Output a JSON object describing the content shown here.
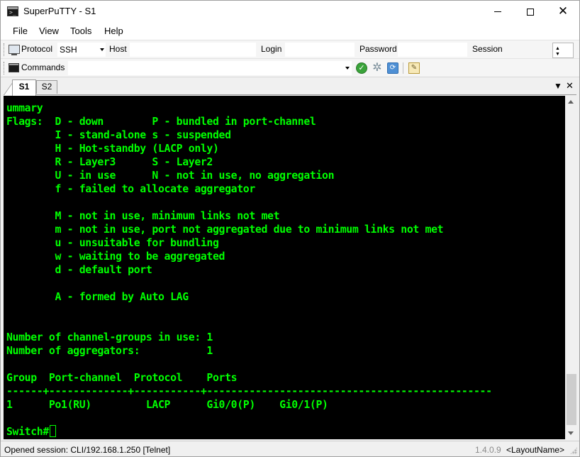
{
  "window": {
    "title": "SuperPuTTY - S1"
  },
  "menu": {
    "items": [
      "File",
      "View",
      "Tools",
      "Help"
    ]
  },
  "toolbar": {
    "protocol_label": "Protocol",
    "protocol_value": "SSH",
    "host_label": "Host",
    "host_value": "",
    "login_label": "Login",
    "login_value": "",
    "password_label": "Password",
    "password_value": "",
    "session_label": "Session",
    "commands_label": "Commands",
    "commands_value": ""
  },
  "tabs": [
    {
      "label": "S1",
      "active": true
    },
    {
      "label": "S2",
      "active": false
    }
  ],
  "terminal": {
    "color": "#00ff00",
    "background": "#000000",
    "lines": [
      "ummary",
      "Flags:  D - down        P - bundled in port-channel",
      "        I - stand-alone s - suspended",
      "        H - Hot-standby (LACP only)",
      "        R - Layer3      S - Layer2",
      "        U - in use      N - not in use, no aggregation",
      "        f - failed to allocate aggregator",
      "",
      "        M - not in use, minimum links not met",
      "        m - not in use, port not aggregated due to minimum links not met",
      "        u - unsuitable for bundling",
      "        w - waiting to be aggregated",
      "        d - default port",
      "",
      "        A - formed by Auto LAG",
      "",
      "",
      "Number of channel-groups in use: 1",
      "Number of aggregators:           1",
      "",
      "Group  Port-channel  Protocol    Ports",
      "------+-------------+-----------+-----------------------------------------------",
      "1      Po1(RU)         LACP      Gi0/0(P)    Gi0/1(P)",
      ""
    ],
    "prompt": "Switch#"
  },
  "status": {
    "session": "Opened session: CLI/192.168.1.250 [Telnet]",
    "version": "1.4.0.9",
    "layout": "<LayoutName>"
  }
}
